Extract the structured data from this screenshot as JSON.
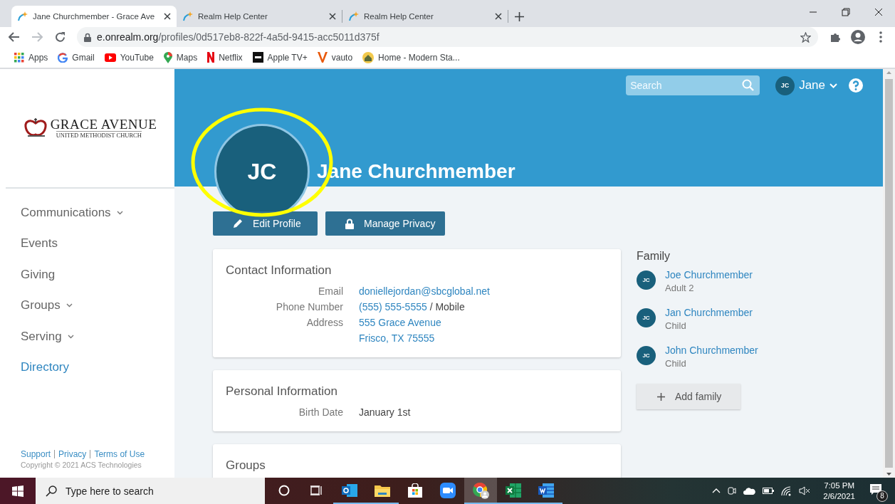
{
  "browser": {
    "tabs": [
      {
        "title": "Jane Churchmember - Grace Ave",
        "selected": true
      },
      {
        "title": "Realm Help Center",
        "selected": false
      },
      {
        "title": "Realm Help Center",
        "selected": false
      }
    ],
    "url": {
      "host": "e.onrealm.org",
      "path": "/profiles/0d517eb8-822f-4a5d-9415-acc5011d375f"
    },
    "bookmarks": [
      {
        "label": "Apps",
        "kind": "apps"
      },
      {
        "label": "Gmail",
        "kind": "google"
      },
      {
        "label": "YouTube",
        "kind": "youtube"
      },
      {
        "label": "Maps",
        "kind": "maps"
      },
      {
        "label": "Netflix",
        "kind": "netflix"
      },
      {
        "label": "Apple TV+",
        "kind": "appletv"
      },
      {
        "label": "vauto",
        "kind": "vauto"
      },
      {
        "label": "Home - Modern Sta...",
        "kind": "home"
      }
    ]
  },
  "sidebar": {
    "logo": {
      "name": "GRACE AVENUE",
      "subtitle": "UNITED METHODIST CHURCH"
    },
    "nav": [
      {
        "label": "Communications",
        "has_menu": true,
        "selected": false
      },
      {
        "label": "Events",
        "has_menu": false,
        "selected": false
      },
      {
        "label": "Giving",
        "has_menu": false,
        "selected": false
      },
      {
        "label": "Groups",
        "has_menu": true,
        "selected": false
      },
      {
        "label": "Serving",
        "has_menu": true,
        "selected": false
      },
      {
        "label": "Directory",
        "has_menu": false,
        "selected": true
      }
    ],
    "footer_links": [
      "Support",
      "Privacy",
      "Terms of Use"
    ],
    "copyright": "Copyright © 2021 ACS Technologies"
  },
  "header": {
    "search": {
      "placeholder": "Search"
    },
    "user": {
      "initials": "JC",
      "name": "Jane"
    }
  },
  "profile": {
    "initials": "JC",
    "name": "Jane Churchmember",
    "actions": [
      {
        "label": "Edit Profile",
        "kind": "edit"
      },
      {
        "label": "Manage Privacy",
        "kind": "privacy"
      }
    ]
  },
  "cards": [
    {
      "title": "Contact Information",
      "fields": [
        {
          "label": "Email",
          "lines": [
            "doniellejordan@sbcglobal.net"
          ],
          "link": true
        },
        {
          "label": "Phone Number",
          "lines": [
            "(555) 555-5555"
          ],
          "note": "/ Mobile",
          "link": true
        },
        {
          "label": "Address",
          "lines": [
            "555 Grace Avenue",
            "Frisco, TX 75555"
          ],
          "link": true
        }
      ]
    },
    {
      "title": "Personal Information",
      "fields": [
        {
          "label": "Birth Date",
          "lines": [
            "January 1st"
          ],
          "link": false
        }
      ]
    },
    {
      "title": "Groups"
    }
  ],
  "family": {
    "title": "Family",
    "members": [
      {
        "initials": "JC",
        "name": "Joe Churchmember",
        "role": "Adult 2"
      },
      {
        "initials": "JC",
        "name": "Jan Churchmember",
        "role": "Child"
      },
      {
        "initials": "JC",
        "name": "John Churchmember",
        "role": "Child"
      }
    ],
    "add_button": "Add family"
  },
  "taskbar": {
    "search": {
      "placeholder": "Type here to search"
    },
    "apps": [
      {
        "kind": "cortana",
        "running": false,
        "selected": false
      },
      {
        "kind": "taskview",
        "running": false,
        "selected": false
      },
      {
        "kind": "outlook",
        "running": true,
        "selected": false
      },
      {
        "kind": "explorer",
        "running": true,
        "selected": false
      },
      {
        "kind": "store",
        "running": false,
        "selected": false
      },
      {
        "kind": "zoom",
        "running": false,
        "selected": false
      },
      {
        "kind": "chrome",
        "running": true,
        "selected": true
      },
      {
        "kind": "excel",
        "running": true,
        "selected": false
      },
      {
        "kind": "word",
        "running": true,
        "selected": false
      }
    ],
    "clock": {
      "time": "7:05 PM",
      "date": "2/6/2021"
    },
    "notifications": "8"
  }
}
